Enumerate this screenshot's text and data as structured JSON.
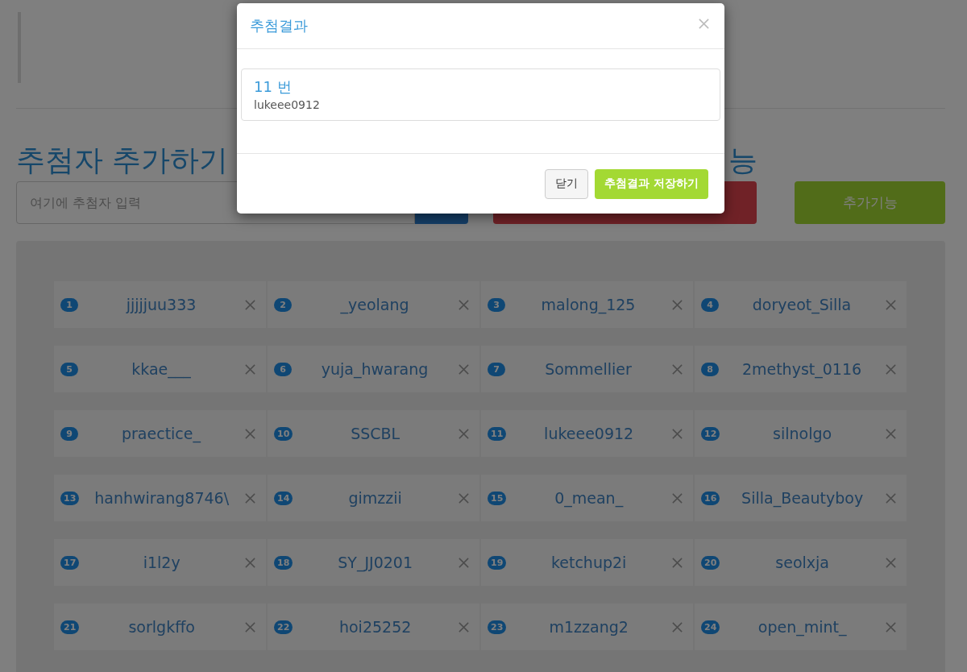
{
  "page": {
    "heading": "추첨자 추가하기",
    "heading_2_visible": "능",
    "input": {
      "placeholder": "여기에 추첨자 입력"
    },
    "extra_button": "추가기능"
  },
  "entries": [
    {
      "number": "1",
      "name": "jjjjjuu333"
    },
    {
      "number": "2",
      "name": "_yeolang"
    },
    {
      "number": "3",
      "name": "malong_125"
    },
    {
      "number": "4",
      "name": "doryeot_Silla"
    },
    {
      "number": "5",
      "name": "kkae___"
    },
    {
      "number": "6",
      "name": "yuja_hwarang"
    },
    {
      "number": "7",
      "name": "Sommellier"
    },
    {
      "number": "8",
      "name": "2methyst_0116"
    },
    {
      "number": "9",
      "name": "praectice_"
    },
    {
      "number": "10",
      "name": "SSCBL"
    },
    {
      "number": "11",
      "name": "lukeee0912"
    },
    {
      "number": "12",
      "name": "silnolgo"
    },
    {
      "number": "13",
      "name": "hanhwirang8746\\"
    },
    {
      "number": "14",
      "name": "gimzzii"
    },
    {
      "number": "15",
      "name": "0_mean_"
    },
    {
      "number": "16",
      "name": "Silla_Beautyboy"
    },
    {
      "number": "17",
      "name": "i1l2y"
    },
    {
      "number": "18",
      "name": "SY_JJ0201"
    },
    {
      "number": "19",
      "name": "ketchup2i"
    },
    {
      "number": "20",
      "name": "seolxja"
    },
    {
      "number": "21",
      "name": "sorlgkffo"
    },
    {
      "number": "22",
      "name": "hoi25252"
    },
    {
      "number": "23",
      "name": "m1zzang2"
    },
    {
      "number": "24",
      "name": "open_mint_"
    }
  ],
  "modal": {
    "title": "추첨결과",
    "result": {
      "number": "11 번",
      "name": "lukeee0912"
    },
    "buttons": [
      {
        "label": "닫기",
        "kind": "default"
      },
      {
        "label": "추첨결과 저장하기",
        "kind": "primary"
      }
    ]
  }
}
